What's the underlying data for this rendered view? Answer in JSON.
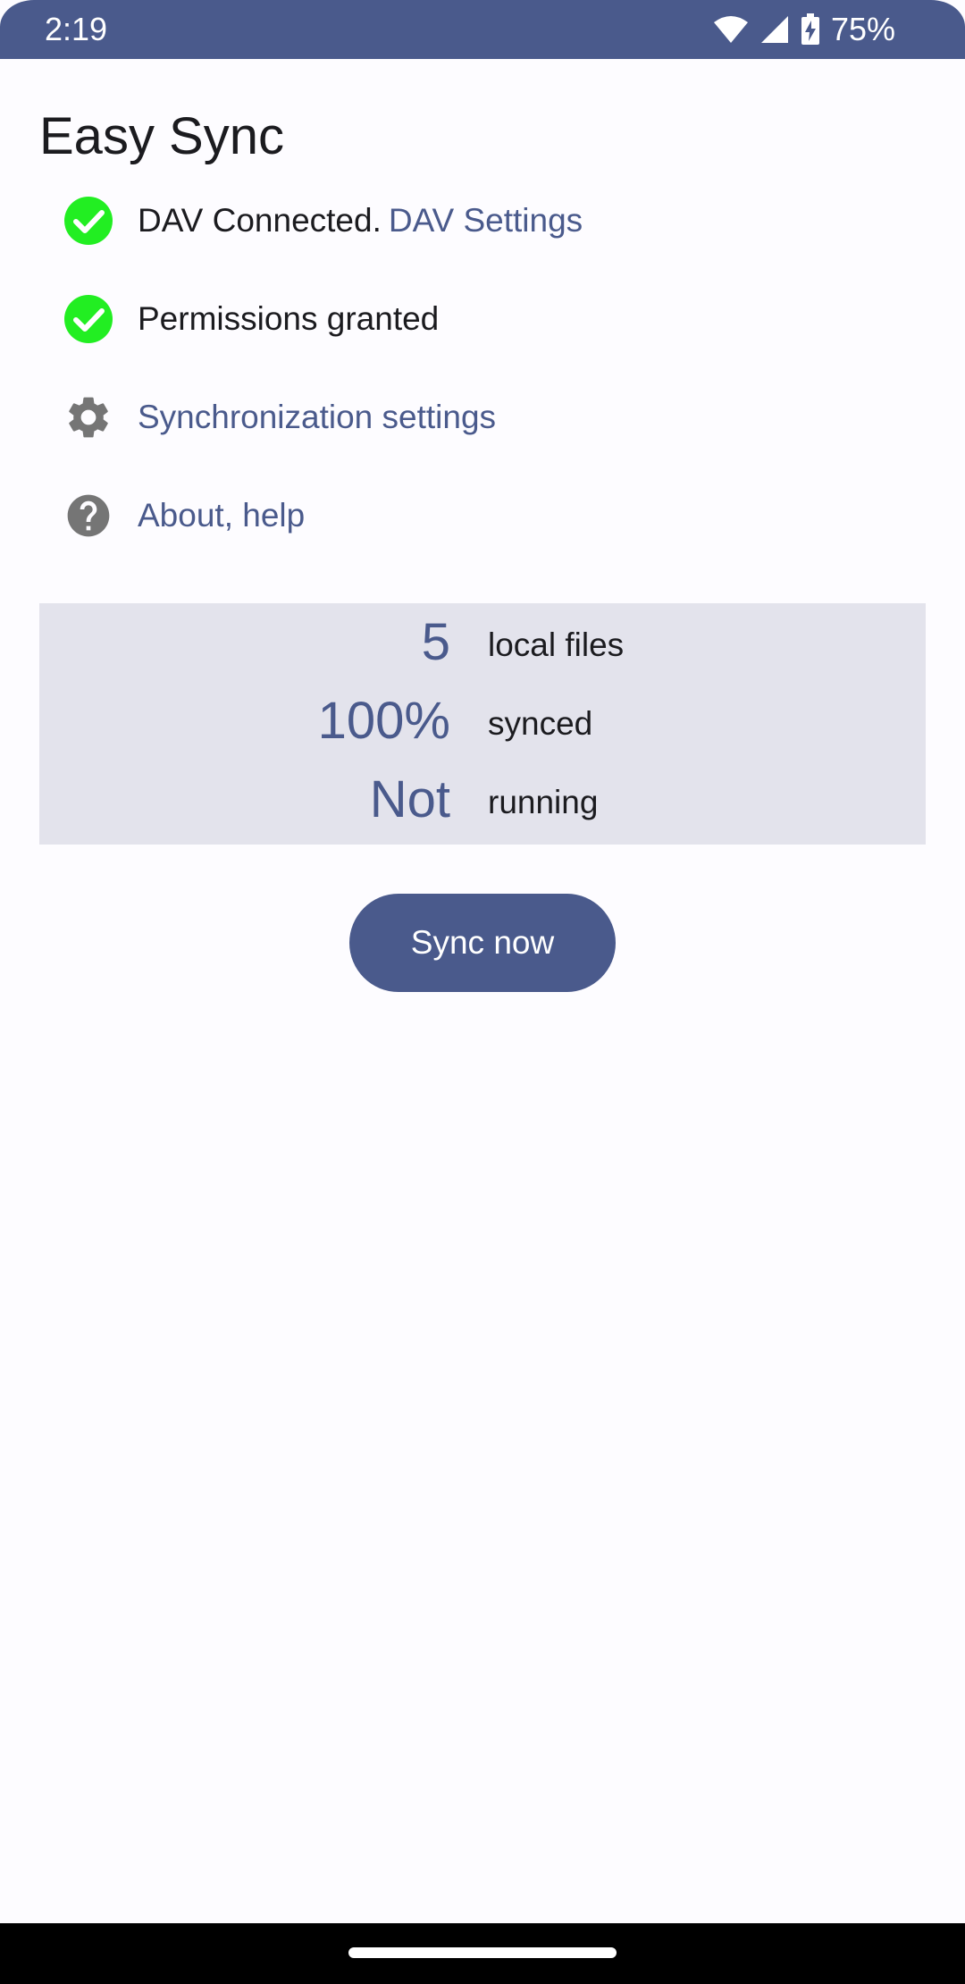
{
  "status_bar": {
    "time": "2:19",
    "battery": "75%",
    "icons": [
      "wifi-icon",
      "cell-signal-icon",
      "battery-charging-icon"
    ]
  },
  "app": {
    "title": "Easy Sync"
  },
  "status_list": {
    "dav": {
      "icon": "check-circle-icon",
      "text": "DAV Connected.",
      "link": "DAV Settings"
    },
    "permissions": {
      "icon": "check-circle-icon",
      "text": "Permissions granted"
    },
    "sync_settings": {
      "icon": "gear-icon",
      "link": "Synchronization settings"
    },
    "about": {
      "icon": "help-circle-icon",
      "link": "About, help"
    }
  },
  "stats": [
    {
      "value": "5",
      "label": "local files"
    },
    {
      "value": "100%",
      "label": "synced"
    },
    {
      "value": "Not",
      "label": "running"
    }
  ],
  "actions": {
    "sync_now_label": "Sync now"
  },
  "colors": {
    "primary": "#4a5a8c",
    "success": "#22ee22",
    "icon_gray": "#757575",
    "panel_bg": "#e3e3ec",
    "background": "#fdfcff"
  }
}
